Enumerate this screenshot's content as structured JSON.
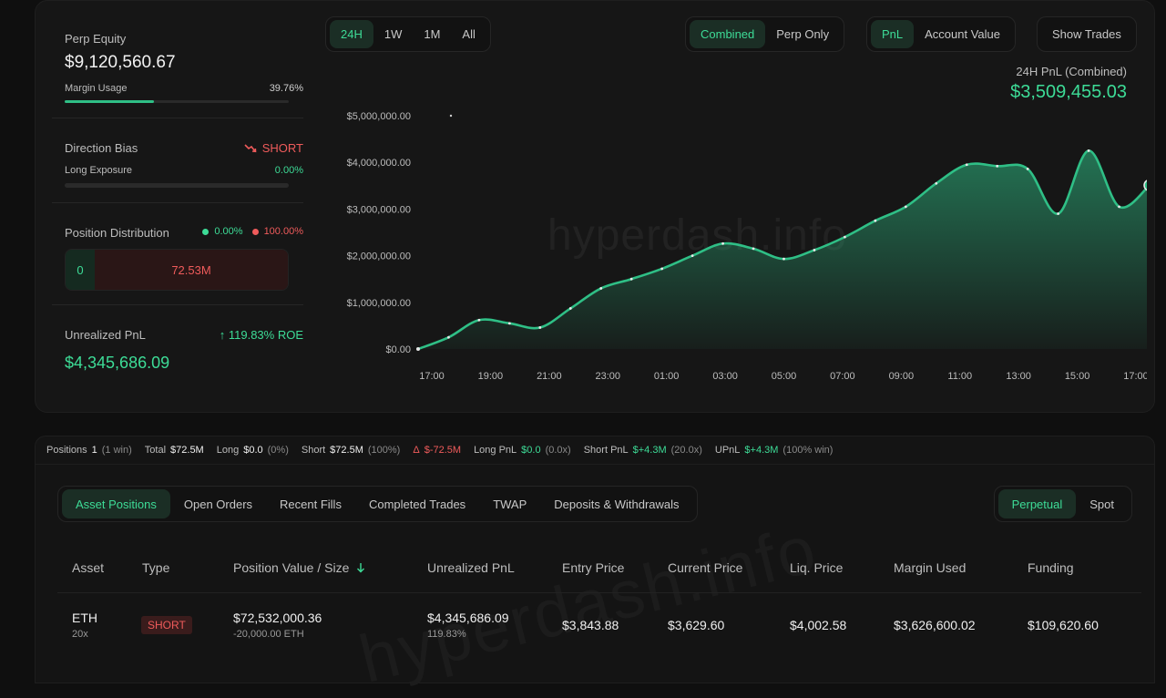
{
  "summary": {
    "perp_equity_label": "Perp Equity",
    "perp_equity_value": "$9,120,560.67",
    "margin_usage_label": "Margin Usage",
    "margin_usage_value": "39.76%",
    "margin_usage_fraction": 0.3976,
    "direction_bias_label": "Direction Bias",
    "direction_bias_value": "SHORT",
    "long_exposure_label": "Long Exposure",
    "long_exposure_value": "0.00%",
    "position_distribution_label": "Position Distribution",
    "dist_long_pct": "0.00%",
    "dist_short_pct": "100.00%",
    "dist_long_value": "0",
    "dist_short_value": "72.53M",
    "unrealized_pnl_label": "Unrealized PnL",
    "unrealized_roe": "119.83% ROE",
    "unrealized_pnl_value": "$4,345,686.09"
  },
  "controls": {
    "timeframes": [
      {
        "label": "24H",
        "active": true
      },
      {
        "label": "1W",
        "active": false
      },
      {
        "label": "1M",
        "active": false
      },
      {
        "label": "All",
        "active": false
      }
    ],
    "scope": [
      {
        "label": "Combined",
        "active": true
      },
      {
        "label": "Perp Only",
        "active": false
      }
    ],
    "metric": [
      {
        "label": "PnL",
        "active": true
      },
      {
        "label": "Account Value",
        "active": false
      }
    ],
    "show_trades_label": "Show Trades"
  },
  "pnl_header": {
    "caption": "24H PnL (Combined)",
    "value": "$3,509,455.03"
  },
  "watermark": "hyperdash.info",
  "chart_data": {
    "type": "area",
    "y_tick_labels": [
      "$5,000,000.00",
      "$4,000,000.00",
      "$3,000,000.00",
      "$2,000,000.00",
      "$1,000,000.00",
      "$0.00"
    ],
    "y_ticks": [
      5000000,
      4000000,
      3000000,
      2000000,
      1000000,
      0
    ],
    "ylim": [
      0,
      5000000
    ],
    "x_tick_labels": [
      "17:00",
      "19:00",
      "21:00",
      "23:00",
      "01:00",
      "03:00",
      "05:00",
      "07:00",
      "09:00",
      "11:00",
      "13:00",
      "15:00",
      "17:00"
    ],
    "series": [
      {
        "x": [
          0,
          1,
          2,
          3,
          4,
          5,
          6,
          7,
          8,
          9,
          10,
          11,
          12,
          13,
          14,
          15,
          16,
          17,
          18,
          19,
          20,
          21,
          22,
          23,
          24
        ],
        "values": [
          0,
          250000,
          620000,
          550000,
          460000,
          870000,
          1300000,
          1500000,
          1720000,
          2000000,
          2260000,
          2150000,
          1930000,
          2120000,
          2400000,
          2750000,
          3050000,
          3550000,
          3950000,
          3920000,
          3860000,
          2900000,
          4250000,
          3050000,
          3509455
        ]
      }
    ],
    "color": "#2fbf86",
    "grid": false
  },
  "stats_bar": [
    {
      "key": "Positions",
      "value": "1",
      "extra": "(1 win)",
      "color": "white"
    },
    {
      "key": "Total",
      "value": "$72.5M",
      "extra": "",
      "color": "white"
    },
    {
      "key": "Long",
      "value": "$0.0",
      "extra": "(0%)",
      "color": "white"
    },
    {
      "key": "Short",
      "value": "$72.5M",
      "extra": "(100%)",
      "color": "white"
    },
    {
      "key": "Δ",
      "value": "$-72.5M",
      "extra": "",
      "color": "red"
    },
    {
      "key": "Long PnL",
      "value": "$0.0",
      "extra": "(0.0x)",
      "color": "green"
    },
    {
      "key": "Short PnL",
      "value": "$+4.3M",
      "extra": "(20.0x)",
      "color": "green"
    },
    {
      "key": "UPnL",
      "value": "$+4.3M",
      "extra": "(100% win)",
      "color": "green"
    }
  ],
  "tabs": [
    {
      "label": "Asset Positions",
      "active": true
    },
    {
      "label": "Open Orders",
      "active": false
    },
    {
      "label": "Recent Fills",
      "active": false
    },
    {
      "label": "Completed Trades",
      "active": false
    },
    {
      "label": "TWAP",
      "active": false
    },
    {
      "label": "Deposits & Withdrawals",
      "active": false
    }
  ],
  "mode_tabs": [
    {
      "label": "Perpetual",
      "active": true
    },
    {
      "label": "Spot",
      "active": false
    }
  ],
  "table": {
    "headers": [
      "Asset",
      "Type",
      "Position Value / Size",
      "Unrealized PnL",
      "Entry Price",
      "Current Price",
      "Liq. Price",
      "Margin Used",
      "Funding"
    ],
    "row": {
      "asset": "ETH",
      "leverage": "20x",
      "type": "SHORT",
      "position_value": "$72,532,000.36",
      "position_size": "-20,000.00 ETH",
      "unrealized_pnl": "$4,345,686.09",
      "unrealized_pct": "119.83%",
      "entry_price": "$3,843.88",
      "current_price": "$3,629.60",
      "liq_price": "$4,002.58",
      "margin_used": "$3,626,600.02",
      "funding": "$109,620.60"
    }
  },
  "icons": {
    "trend_down": "trend-down-icon",
    "arrow_up": "arrow-up-icon",
    "sort_down": "sort-down-icon"
  }
}
